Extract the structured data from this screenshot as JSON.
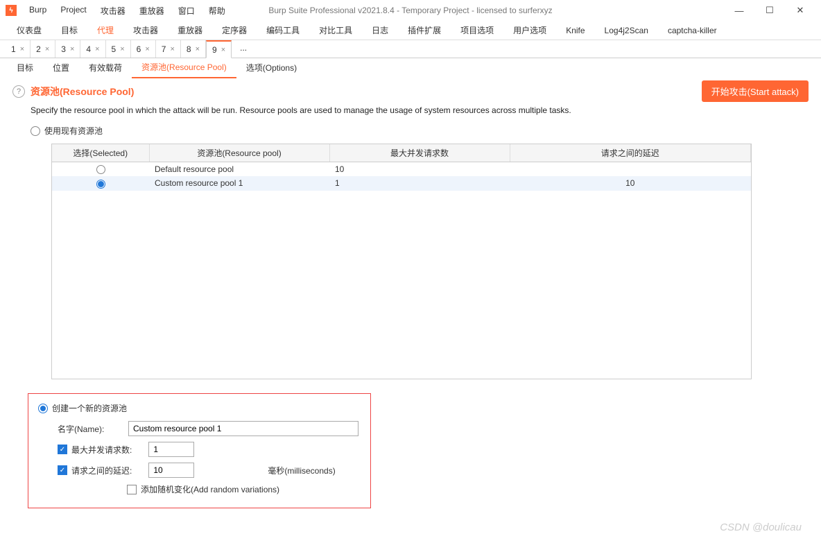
{
  "menu": {
    "burp": "Burp",
    "project": "Project",
    "attacker": "攻击器",
    "repeater": "重放器",
    "window": "窗口",
    "help": "帮助"
  },
  "title": "Burp Suite Professional v2021.8.4 - Temporary Project - licensed to surferxyz",
  "main_tabs": {
    "dashboard": "仪表盘",
    "target": "目标",
    "proxy": "代理",
    "intruder": "攻击器",
    "repeater": "重放器",
    "sequencer": "定序器",
    "decoder": "编码工具",
    "comparer": "对比工具",
    "logger": "日志",
    "extender": "插件扩展",
    "project_opts": "项目选项",
    "user_opts": "用户选项",
    "knife": "Knife",
    "log4j": "Log4j2Scan",
    "captcha": "captcha-killer"
  },
  "num_tabs": [
    "1",
    "2",
    "3",
    "4",
    "5",
    "6",
    "7",
    "8",
    "9"
  ],
  "num_more": "...",
  "sub_tabs": {
    "target": "目标",
    "positions": "位置",
    "payloads": "有效载荷",
    "pool": "资源池(Resource Pool)",
    "options": "选项(Options)"
  },
  "heading": "资源池(Resource Pool)",
  "start_attack": "开始攻击(Start attack)",
  "description": "Specify the resource pool in which the attack will be run. Resource pools are used to manage the usage of system resources across multiple tasks.",
  "use_existing": "使用现有资源池",
  "table_headers": {
    "selected": "选择(Selected)",
    "pool": "资源池(Resource pool)",
    "max_req": "最大并发请求数",
    "delay": "请求之间的延迟"
  },
  "table_rows": [
    {
      "selected": false,
      "pool": "Default resource pool",
      "max_req": "10",
      "delay": ""
    },
    {
      "selected": true,
      "pool": "Custom resource pool 1",
      "max_req": "1",
      "delay": "10"
    }
  ],
  "create_new": "创建一个新的资源池",
  "name_label": "名字(Name):",
  "name_value": "Custom resource pool 1",
  "max_req_label": "最大并发请求数:",
  "max_req_value": "1",
  "delay_label": "请求之间的延迟:",
  "delay_value": "10",
  "ms_label": "毫秒(milliseconds)",
  "random_label": "添加随机变化(Add random variations)",
  "watermark": "CSDN @doulicau"
}
